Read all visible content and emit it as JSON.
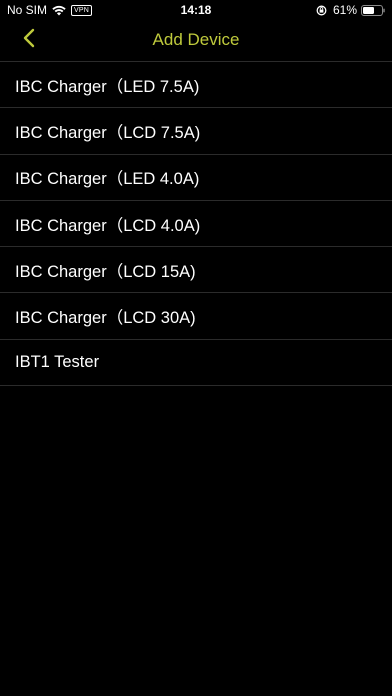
{
  "colors": {
    "background": "#000000",
    "accent": "#bfca3c",
    "text": "#ffffff",
    "divider": "#2b2b2b"
  },
  "status_bar": {
    "carrier": "No SIM",
    "vpn": "VPN",
    "time": "14:18",
    "battery_percent": "61%",
    "battery_level": 0.61,
    "icons": [
      "wifi-icon",
      "rotation-lock-icon",
      "battery-icon"
    ]
  },
  "nav": {
    "back_icon": "chevron-left-icon",
    "title": "Add Device"
  },
  "devices": [
    {
      "label": "IBC Charger（LED 7.5A)"
    },
    {
      "label": "IBC Charger（LCD 7.5A)"
    },
    {
      "label": "IBC Charger（LED 4.0A)"
    },
    {
      "label": "IBC Charger（LCD 4.0A)"
    },
    {
      "label": "IBC Charger（LCD 15A)"
    },
    {
      "label": "IBC Charger（LCD 30A)"
    },
    {
      "label": "IBT1 Tester"
    }
  ]
}
